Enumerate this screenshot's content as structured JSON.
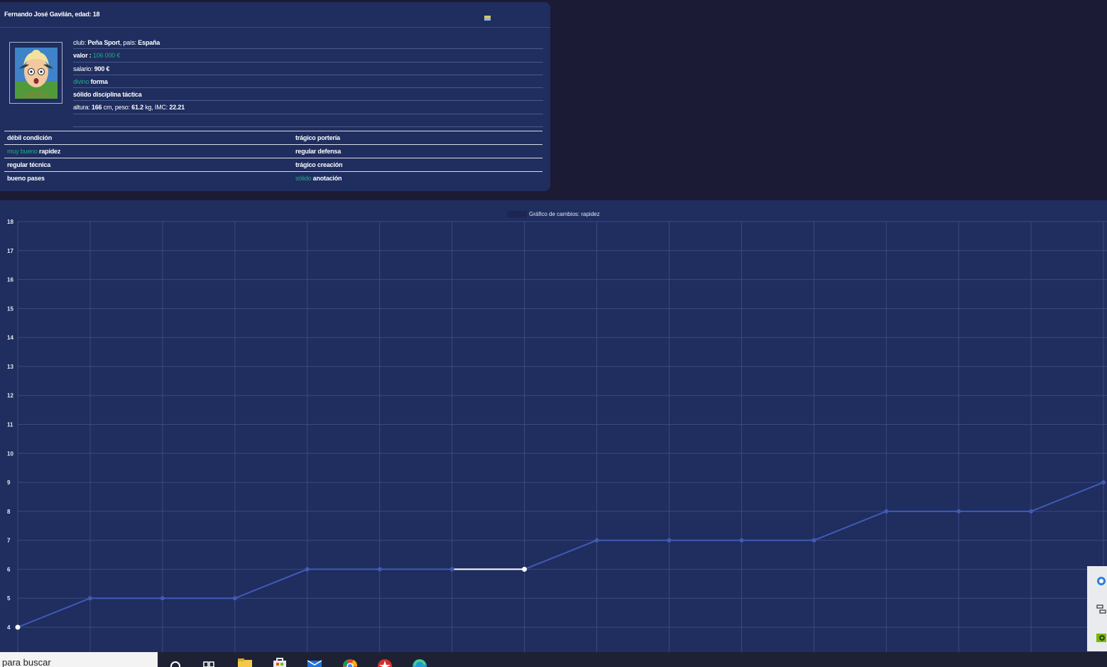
{
  "player": {
    "title": "Fernando José Gavilán, edad: 18",
    "club_label": "club: ",
    "club": "Peña Sport",
    "country_label": ", país: ",
    "country": "España",
    "value_label": "valor : ",
    "value": "106 000 €",
    "salary_label": "salario: ",
    "salary": "900 €",
    "form_level": "divino",
    "form_label": " forma",
    "discipline": "sólido disciplina táctica",
    "height_label": "altura: ",
    "height": "166",
    "height_unit": " cm, peso: ",
    "weight": "61.2",
    "weight_unit": " kg, IMC: ",
    "bmi": "22.21"
  },
  "skills": [
    {
      "left_level": "débil",
      "left_skill": " condición",
      "left_green": false,
      "right_level": "trágico",
      "right_skill": " portería",
      "right_green": false
    },
    {
      "left_level": "muy bueno",
      "left_skill": " rapidez",
      "left_green": true,
      "right_level": "regular",
      "right_skill": " defensa",
      "right_green": false
    },
    {
      "left_level": "regular",
      "left_skill": " técnica",
      "left_green": false,
      "right_level": "trágico",
      "right_skill": " creación",
      "right_green": false
    },
    {
      "left_level": "bueno",
      "left_skill": " pases",
      "left_green": false,
      "right_level": "sólido",
      "right_skill": " anotación",
      "right_green": true
    }
  ],
  "chart_data": {
    "type": "line",
    "title": "Gráfico de cambios: rapidez",
    "legend": "top-center",
    "grid": true,
    "ylim": [
      4,
      18
    ],
    "yticks": [
      4,
      5,
      6,
      7,
      8,
      9,
      10,
      11,
      12,
      13,
      14,
      15,
      16,
      17,
      18
    ],
    "series": [
      {
        "values": [
          4,
          5,
          5,
          5,
          6,
          6,
          6,
          6,
          7,
          7,
          7,
          7,
          8,
          8,
          8,
          9
        ]
      }
    ],
    "highlight_segment": [
      6,
      7
    ],
    "colors": {
      "line": "#3f5bb5",
      "highlight": "#ffffff",
      "grid": "#3a4a80"
    }
  },
  "taskbar": {
    "search_text": "para buscar",
    "icons": [
      "search-icon",
      "task-view-icon",
      "file-explorer-icon",
      "store-icon",
      "mail-icon",
      "chrome-icon",
      "app-icon",
      "edge-icon"
    ]
  },
  "tray": {
    "icons": [
      "update-icon",
      "network-icon",
      "nvidia-icon"
    ]
  },
  "colors": {
    "page_bg": "#1b1b35",
    "card_bg": "#1f2d5f",
    "accent_green": "#1fae86"
  }
}
